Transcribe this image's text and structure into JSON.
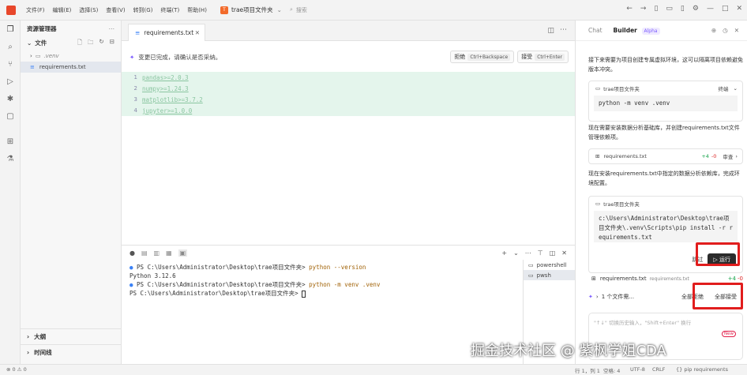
{
  "titlebar": {
    "menus": [
      "文件(F)",
      "编辑(E)",
      "选择(S)",
      "查看(V)",
      "转到(G)",
      "终端(T)",
      "帮助(H)"
    ],
    "project_badge": "T",
    "project": "trae项目文件夹",
    "search_placeholder": "搜索"
  },
  "explorer": {
    "title": "资源管理器",
    "section": "文件",
    "items": [
      ".venv",
      "requirements.txt"
    ],
    "outline": "大纲",
    "timeline": "时间线"
  },
  "editor": {
    "tab": "requirements.txt",
    "banner": "变更已完成，请确认是否采纳。",
    "reject": "拒绝",
    "reject_kbd": "Ctrl+Backspace",
    "accept": "接受",
    "accept_kbd": "Ctrl+Enter",
    "lines": [
      {
        "n": "1",
        "code": "pandas>=2.0.3"
      },
      {
        "n": "2",
        "code": "numpy>=1.24.3"
      },
      {
        "n": "3",
        "code": "matplotlib>=3.7.2"
      },
      {
        "n": "4",
        "code": "jupyter>=1.0.0"
      }
    ]
  },
  "terminal": {
    "l1_prompt": "PS C:\\Users\\Administrator\\Desktop\\trae项目文件夹> ",
    "l1_cmd": "python --version",
    "l2": "Python 3.12.6",
    "l3_prompt": "PS C:\\Users\\Administrator\\Desktop\\trae项目文件夹> ",
    "l3_cmd": "python -m venv .venv",
    "l4_prompt": "PS C:\\Users\\Administrator\\Desktop\\trae项目文件夹> ",
    "shells": [
      "powershell",
      "pwsh"
    ]
  },
  "right": {
    "tab_chat": "Chat",
    "tab_builder": "Builder",
    "tab_badge": "Alpha",
    "msg1": "接下来需要为项目创建专属虚拟环境，这可以隔离项目依赖避免版本冲突。",
    "card1_title": "trae项目文件夹",
    "card1_action": "终端",
    "card1_cmd": "python -m venv .venv",
    "msg2": "现在需要安装数据分析基础库，并创建requirements.txt文件管理依赖项。",
    "card2_file": "requirements.txt",
    "card2_add": "+4",
    "card2_del": "-0",
    "card2_action": "审查",
    "msg3": "现在安装requirements.txt中指定的数据分析依赖库，完成环境配置。",
    "card3_title": "trae项目文件夹",
    "card3_cmd": "c:\\Users\\Administrator\\Desktop\\trae项目文件夹\\.venv\\Scripts\\pip install -r requirements.txt",
    "skip": "跳过",
    "run": "运行",
    "file_row": "requirements.txt",
    "file_row_sub": "requirements.txt",
    "file_add": "+4",
    "file_del": "-0",
    "summary": "1 个文件需...",
    "reject_all": "全部拒绝",
    "accept_all": "全部接受",
    "input_placeholder": "\"↑↓\" 切换历史输入，\"Shift+Enter\" 换行",
    "new_badge": "New"
  },
  "statusbar": {
    "left": "⊗ 0  ⚠ 0",
    "pos": "行 1，列 1",
    "spaces": "空格: 4",
    "enc": "UTF-8",
    "eol": "CRLF",
    "lang": "{}  pip requirements"
  },
  "watermark": "掘金技术社区 @ 紫枫学姐CDA"
}
